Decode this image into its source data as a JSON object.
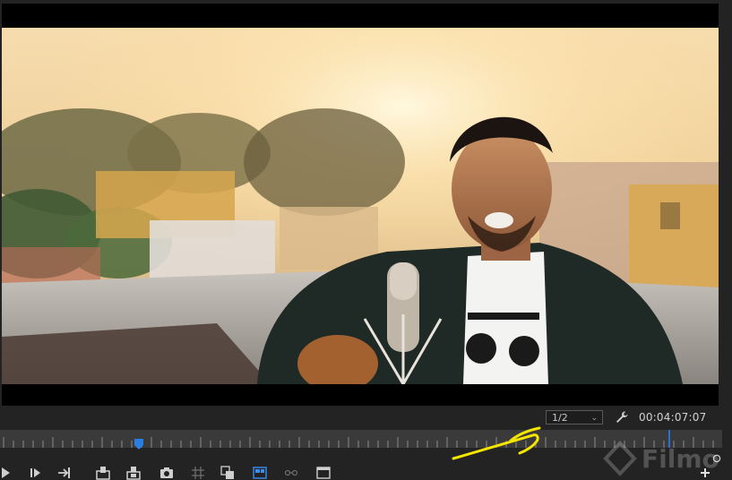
{
  "monitor": {
    "fit_select": {
      "value": "1/2",
      "chevron": "chevron-down-icon"
    },
    "settings_icon": "wrench-icon",
    "timecode": "00:04:07:07"
  },
  "timeline": {
    "playhead_color": "#2a7de1",
    "out_point_color": "#2a6fd6"
  },
  "transport": {
    "buttons": [
      "play-icon",
      "step-forward-icon",
      "go-to-out-icon",
      "lift-icon",
      "extract-icon",
      "export-frame-icon",
      "safe-margins-icon",
      "comparison-view-icon",
      "multicam-icon",
      "vr-video-icon",
      "toggle-proxies-icon",
      "add-button-icon"
    ]
  },
  "annotation": {
    "color": "#f5e400"
  },
  "watermark": {
    "text": "Filmo"
  }
}
